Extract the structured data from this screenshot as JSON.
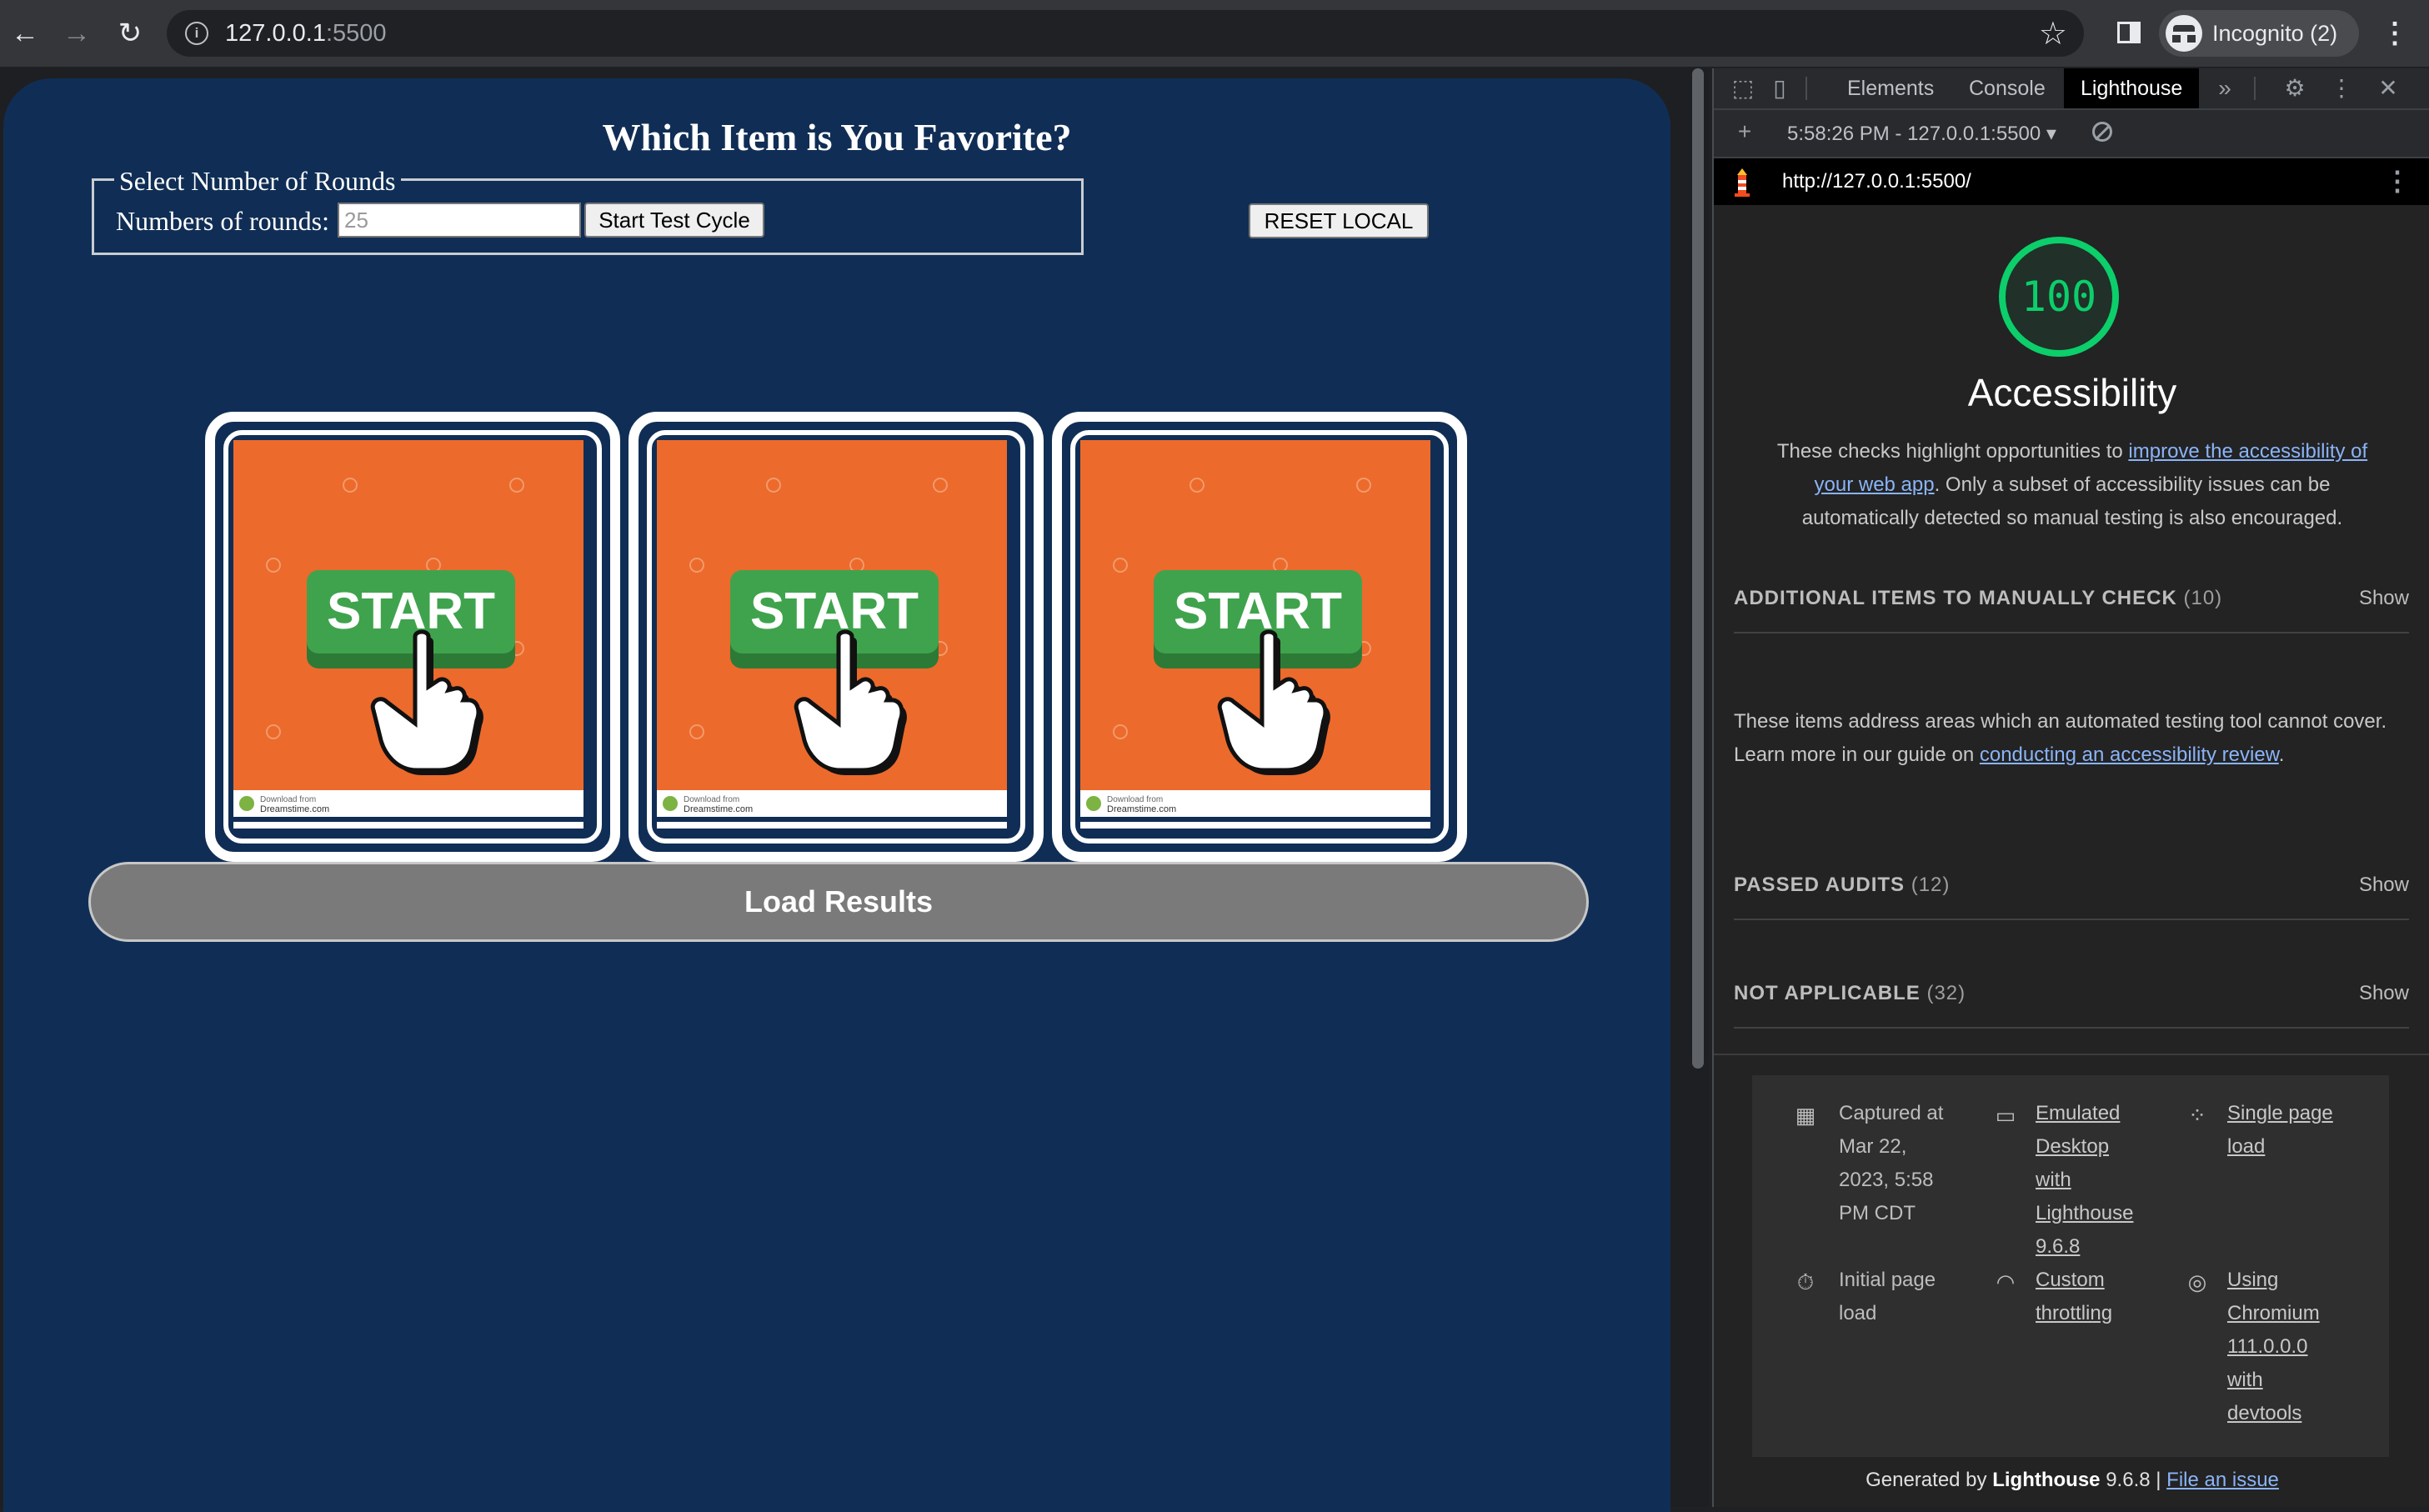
{
  "browser": {
    "url_host": "127.0.0.1",
    "url_port": ":5500",
    "profile_label": "Incognito (2)",
    "icons": {
      "back": "back-arrow-icon",
      "forward": "forward-arrow-icon",
      "reload": "reload-icon",
      "bookmark": "star-icon"
    }
  },
  "page": {
    "title": "Which Item is You Favorite?",
    "rounds_legend": "Select Number of Rounds",
    "rounds_label": "Numbers of rounds:",
    "rounds_placeholder": "25",
    "start_button": "Start Test Cycle",
    "reset_button": "RESET LOCAL",
    "cards": [
      {
        "label": "START",
        "watermark_top": "Download from",
        "watermark_brand": "Dreamstime.com"
      },
      {
        "label": "START",
        "watermark_top": "Download from",
        "watermark_brand": "Dreamstime.com"
      },
      {
        "label": "START",
        "watermark_top": "Download from",
        "watermark_brand": "Dreamstime.com"
      }
    ],
    "load_results": "Load Results",
    "colors": {
      "background": "#102e55",
      "card_orange": "#ec6a2c",
      "start_green": "#3fa34d"
    }
  },
  "devtools": {
    "tabs": [
      "Elements",
      "Console",
      "Lighthouse"
    ],
    "active_tab": "Lighthouse",
    "report_selector": "5:58:26 PM - 127.0.0.1:5500 ▾",
    "report_url": "http://127.0.0.1:5500/",
    "score": "100",
    "category": "Accessibility",
    "desc_before": "These checks highlight opportunities to ",
    "desc_link": "improve the accessibility of your web app",
    "desc_after": ". Only a subset of accessibility issues can be automatically detected so manual testing is also encouraged.",
    "groups": [
      {
        "title": "ADDITIONAL ITEMS TO MANUALLY CHECK",
        "count": "(10)",
        "action": "Show"
      },
      {
        "title": "PASSED AUDITS",
        "count": "(12)",
        "action": "Show"
      },
      {
        "title": "NOT APPLICABLE",
        "count": "(32)",
        "action": "Show"
      }
    ],
    "manual_desc_before": "These items address areas which an automated testing tool cannot cover. Learn more in our guide on ",
    "manual_desc_link": "conducting an accessibility review",
    "manual_desc_after": ".",
    "env": {
      "captured": [
        "Captured at",
        "Mar 22,",
        "2023, 5:58",
        "PM CDT"
      ],
      "emulated": [
        "Emulated",
        "Desktop",
        "with",
        "Lighthouse",
        "9.6.8"
      ],
      "single": [
        "Single page",
        "load"
      ],
      "initial": [
        "Initial page",
        "load"
      ],
      "throttling": [
        "Custom",
        "throttling"
      ],
      "chromium": [
        "Using",
        "Chromium",
        "111.0.0.0",
        "with",
        "devtools"
      ]
    },
    "footer_prefix": "Generated by ",
    "footer_brand": "Lighthouse",
    "footer_version": " 9.6.8 | ",
    "footer_link": "File an issue",
    "score_color": "#0cce6b"
  }
}
